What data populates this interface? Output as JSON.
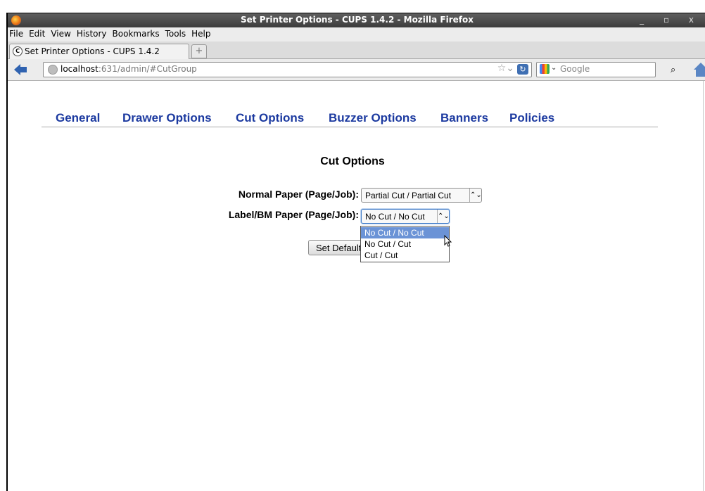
{
  "window": {
    "title": "Set Printer Options - CUPS 1.4.2 - Mozilla Firefox",
    "controls": "_ ▫ x"
  },
  "menu": [
    "File",
    "Edit",
    "View",
    "History",
    "Bookmarks",
    "Tools",
    "Help"
  ],
  "tab": {
    "label": "Set Printer Options - CUPS 1.4.2",
    "new_tab": "+"
  },
  "address": {
    "host": "localhost",
    "rest": ":631/admin/#CutGroup"
  },
  "search": {
    "placeholder": "Google"
  },
  "cups_tabs": [
    "General",
    "Drawer Options",
    "Cut Options",
    "Buzzer Options",
    "Banners",
    "Policies"
  ],
  "section": {
    "heading": "Cut Options"
  },
  "options": [
    {
      "label": "Normal Paper (Page/Job):",
      "value": "Partial Cut / Partial Cut"
    },
    {
      "label": "Label/BM Paper (Page/Job):",
      "value": "No Cut / No Cut"
    }
  ],
  "submit_label": "Set Default Options",
  "dropdown": {
    "items": [
      "No Cut / No Cut",
      "No Cut / Cut",
      "Cut / Cut"
    ],
    "selected_index": 0
  }
}
